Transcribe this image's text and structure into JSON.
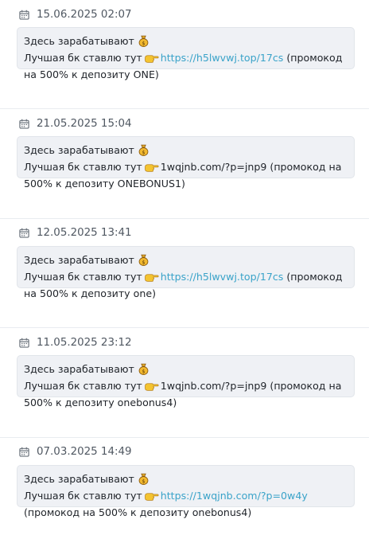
{
  "posts": [
    {
      "date": "15.06.2025 02:07",
      "line1": "Здесь зарабатывают",
      "line2_prefix": "Лучшая бк ставлю тут",
      "link": "https://h5lwvwj.top/17cs",
      "link_is_url": true,
      "after_link": " (промокод",
      "line3": "на 500% к депозиту ONE)"
    },
    {
      "date": "21.05.2025 15:04",
      "line1": "Здесь зарабатывают",
      "line2_prefix": "Лучшая бк ставлю тут",
      "link": "1wqjnb.com/?p=jnp9",
      "link_is_url": false,
      "after_link": " (промокод на",
      "line3": "500% к депозиту ONEBONUS1)"
    },
    {
      "date": "12.05.2025 13:41",
      "line1": "Здесь зарабатывают",
      "line2_prefix": "Лучшая бк ставлю тут",
      "link": "https://h5lwvwj.top/17cs",
      "link_is_url": true,
      "after_link": " (промокод",
      "line3": "на 500% к депозиту one)"
    },
    {
      "date": "11.05.2025 23:12",
      "line1": "Здесь зарабатывают",
      "line2_prefix": "Лучшая бк ставлю тут",
      "link": "1wqjnb.com/?p=jnp9",
      "link_is_url": false,
      "after_link": " (промокод на",
      "line3": "500% к депозиту onebonus4)"
    },
    {
      "date": "07.03.2025 14:49",
      "line1": "Здесь зарабатывают",
      "line2_prefix": "Лучшая бк ставлю тут",
      "link": "https://1wqjnb.com/?p=0w4y",
      "link_is_url": true,
      "after_link": "",
      "line3": "(промокод на 500% к депозиту onebonus4)"
    }
  ],
  "icons": {
    "date": "calendar-icon",
    "money": "money-bag-icon",
    "pointer": "pointing-hand-icon"
  },
  "colors": {
    "link": "#3aa3c9",
    "bubble_bg": "#eff1f5",
    "date_text": "#505862"
  }
}
